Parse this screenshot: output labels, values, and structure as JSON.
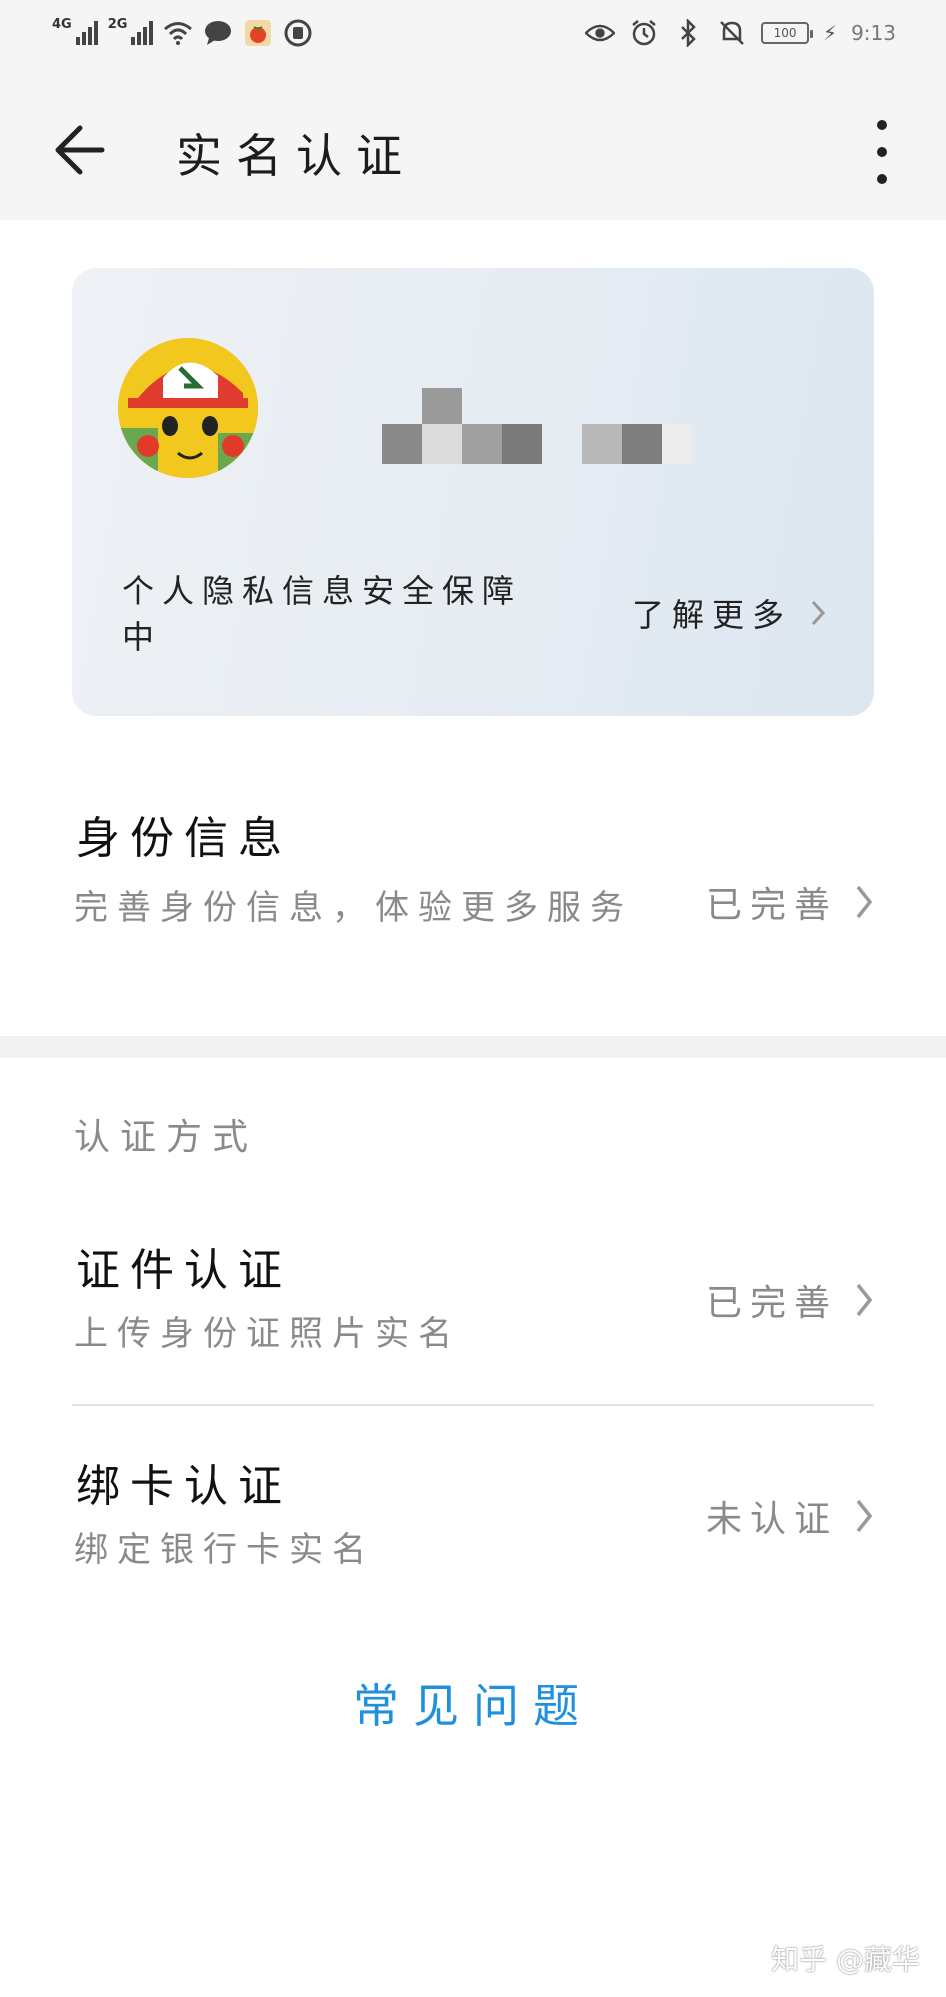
{
  "status_bar": {
    "network1": "4G",
    "network2": "2G",
    "battery": "100",
    "time": "9:13"
  },
  "app_bar": {
    "title": "实名认证"
  },
  "privacy_card": {
    "note": "个人隐私信息安全保障中",
    "learn_more": "了解更多"
  },
  "identity": {
    "title": "身份信息",
    "subtitle": "完善身份信息，体验更多服务",
    "status": "已完善"
  },
  "auth_methods": {
    "label": "认证方式",
    "items": [
      {
        "title": "证件认证",
        "subtitle": "上传身份证照片实名",
        "status": "已完善"
      },
      {
        "title": "绑卡认证",
        "subtitle": "绑定银行卡实名",
        "status": "未认证"
      }
    ]
  },
  "faq": "常见问题",
  "watermark": "知乎 @藏华",
  "colors": {
    "accent": "#1f8fe0",
    "header_bg": "#f5f5f5",
    "muted_text": "#8a8a8a"
  }
}
